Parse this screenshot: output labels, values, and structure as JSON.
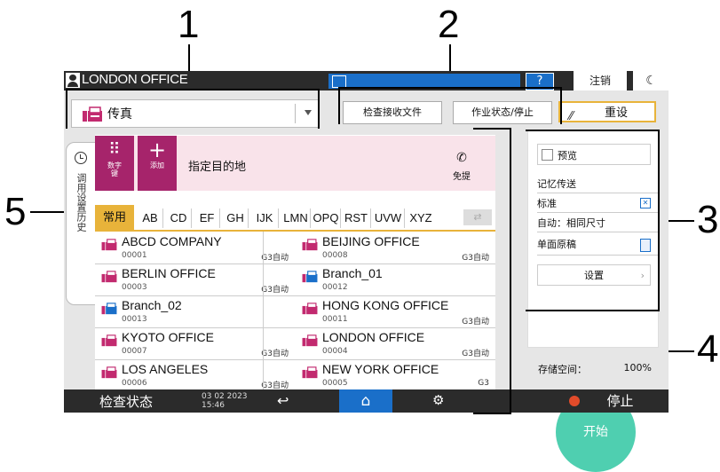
{
  "callouts": [
    "1",
    "2",
    "3",
    "4",
    "5"
  ],
  "header": {
    "office": "LONDON OFFICE",
    "help": "?",
    "logout": "注销",
    "moon": "☾"
  },
  "app_selector": {
    "label": "传真"
  },
  "top_buttons": {
    "check_received": "检查接收文件",
    "job_status": "作业状态/停止",
    "reset": "重设"
  },
  "dest": {
    "numpad_label": "数字键",
    "add_label": "添加",
    "specify": "指定目的地",
    "onhook": "免提"
  },
  "tabs": [
    "常用",
    "AB",
    "CD",
    "EF",
    "GH",
    "IJK",
    "LMN",
    "OPQ",
    "RST",
    "UVW",
    "XYZ"
  ],
  "entries": [
    {
      "name": "ABCD COMPANY",
      "num": "00001",
      "mode": "G3自动"
    },
    {
      "name": "BEIJING OFFICE",
      "num": "00008",
      "mode": "G3自动"
    },
    {
      "name": "BERLIN OFFICE",
      "num": "00003",
      "mode": "G3自动"
    },
    {
      "name": "Branch_01",
      "num": "00012",
      "mode": ""
    },
    {
      "name": "Branch_02",
      "num": "00013",
      "mode": ""
    },
    {
      "name": "HONG KONG OFFICE",
      "num": "00011",
      "mode": "G3自动"
    },
    {
      "name": "KYOTO OFFICE",
      "num": "00007",
      "mode": "G3自动"
    },
    {
      "name": "LONDON OFFICE",
      "num": "00004",
      "mode": "G3自动"
    },
    {
      "name": "LOS ANGELES",
      "num": "00006",
      "mode": "G3自动"
    },
    {
      "name": "NEW YORK OFFICE",
      "num": "00005",
      "mode": "G3"
    }
  ],
  "right_panel": {
    "preview": "预览",
    "memory_tx": "记忆传送",
    "resolution": "标准",
    "size": "自动：相同尺寸",
    "sides": "单面原稿",
    "settings": "设置",
    "storage_label": "存储空间：",
    "storage_value": "100%"
  },
  "history_tab": "调用设置历史",
  "start": "开始",
  "bottom": {
    "check_status": "检查状态",
    "date": "03 02 2023",
    "time": "15:46",
    "stop": "停止"
  }
}
